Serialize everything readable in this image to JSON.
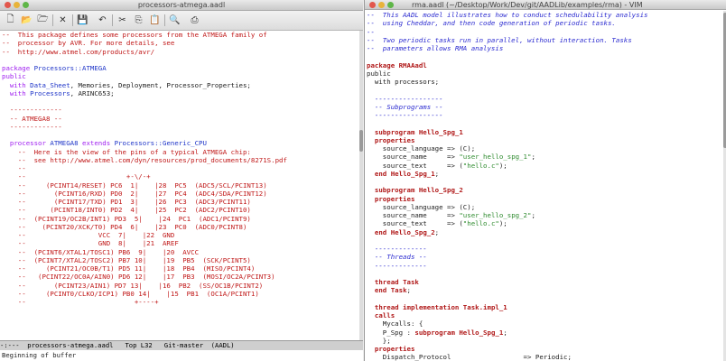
{
  "left_window": {
    "title": "processors-atmega.aadl",
    "toolbar_icons": [
      {
        "name": "new-file-icon",
        "glyph": "🗋"
      },
      {
        "name": "open-folder-icon",
        "glyph": "📂"
      },
      {
        "name": "open-dir-icon",
        "glyph": "🗁"
      },
      {
        "name": "close-icon",
        "glyph": "✕"
      },
      {
        "name": "save-icon",
        "glyph": "💾"
      },
      {
        "name": "undo-icon",
        "glyph": "↶"
      },
      {
        "name": "cut-icon",
        "glyph": "✂"
      },
      {
        "name": "copy-icon",
        "glyph": "⎘"
      },
      {
        "name": "paste-icon",
        "glyph": "📋"
      },
      {
        "name": "search-icon",
        "glyph": "🔍"
      },
      {
        "name": "print-icon",
        "glyph": "⎙"
      }
    ],
    "lines": [
      [
        {
          "c": "com",
          "t": "--  This package defines some processors from the ATMEGA family of"
        }
      ],
      [
        {
          "c": "com",
          "t": "--  processor by AVR. For more details, see"
        }
      ],
      [
        {
          "c": "com",
          "t": "--  http://www.atmel.com/products/avr/"
        }
      ],
      [
        {
          "c": "txt",
          "t": ""
        }
      ],
      [
        {
          "c": "kw",
          "t": "package "
        },
        {
          "c": "type",
          "t": "Processors::ATMEGA"
        }
      ],
      [
        {
          "c": "kw",
          "t": "public"
        }
      ],
      [
        {
          "c": "txt",
          "t": "  "
        },
        {
          "c": "kw",
          "t": "with "
        },
        {
          "c": "type",
          "t": "Data_Sheet"
        },
        {
          "c": "txt",
          "t": ", Memories, Deployment, Processor_Properties;"
        }
      ],
      [
        {
          "c": "txt",
          "t": "  "
        },
        {
          "c": "kw",
          "t": "with "
        },
        {
          "c": "type",
          "t": "Processors"
        },
        {
          "c": "txt",
          "t": ", ARINC653;"
        }
      ],
      [
        {
          "c": "txt",
          "t": ""
        }
      ],
      [
        {
          "c": "com",
          "t": "  -------------"
        }
      ],
      [
        {
          "c": "com",
          "t": "  -- ATMEGA8 --"
        }
      ],
      [
        {
          "c": "com",
          "t": "  -------------"
        }
      ],
      [
        {
          "c": "txt",
          "t": ""
        }
      ],
      [
        {
          "c": "txt",
          "t": "  "
        },
        {
          "c": "kw",
          "t": "processor "
        },
        {
          "c": "type",
          "t": "ATMEGA8"
        },
        {
          "c": "kw",
          "t": " extends "
        },
        {
          "c": "type",
          "t": "Processors::Generic_CPU"
        }
      ],
      [
        {
          "c": "com",
          "t": "    --  Here is the view of the pins of a typical ATMEGA chip:"
        }
      ],
      [
        {
          "c": "com",
          "t": "    --  see http://www.atmel.com/dyn/resources/prod_documents/8271S.pdf"
        }
      ],
      [
        {
          "c": "com",
          "t": "    --"
        }
      ],
      [
        {
          "c": "com",
          "t": "    --                         +-\\/-+"
        }
      ],
      [
        {
          "c": "com",
          "t": "    --     (PCINT14/RESET) PC6  1|    |28  PC5  (ADC5/SCL/PCINT13)"
        }
      ],
      [
        {
          "c": "com",
          "t": "    --       (PCINT16/RXD) PD0  2|    |27  PC4  (ADC4/SDA/PCINT12)"
        }
      ],
      [
        {
          "c": "com",
          "t": "    --       (PCINT17/TXD) PD1  3|    |26  PC3  (ADC3/PCINT11)"
        }
      ],
      [
        {
          "c": "com",
          "t": "    --      (PCINT18/INT0) PD2  4|    |25  PC2  (ADC2/PCINT10)"
        }
      ],
      [
        {
          "c": "com",
          "t": "    --  (PCINT19/OC2B/INT1) PD3  5|    |24  PC1  (ADC1/PCINT9)"
        }
      ],
      [
        {
          "c": "com",
          "t": "    --    (PCINT20/XCK/T0) PD4  6|    |23  PC0  (ADC0/PCINT8)"
        }
      ],
      [
        {
          "c": "com",
          "t": "    --                  VCC  7|    |22  GND"
        }
      ],
      [
        {
          "c": "com",
          "t": "    --                  GND  8|    |21  AREF"
        }
      ],
      [
        {
          "c": "com",
          "t": "    --  (PCINT6/XTAL1/TOSC1) PB6  9|    |20  AVCC"
        }
      ],
      [
        {
          "c": "com",
          "t": "    --  (PCINT7/XTAL2/TOSC2) PB7 10|    |19  PB5  (SCK/PCINT5)"
        }
      ],
      [
        {
          "c": "com",
          "t": "    --     (PCINT21/OC0B/T1) PD5 11|    |18  PB4  (MISO/PCINT4)"
        }
      ],
      [
        {
          "c": "com",
          "t": "    --   (PCINT22/OC0A/AIN0) PD6 12|    |17  PB3  (MOSI/OC2A/PCINT3)"
        }
      ],
      [
        {
          "c": "com",
          "t": "    --       (PCINT23/AIN1) PD7 13|    |16  PB2  (SS/OC1B/PCINT2)"
        }
      ],
      [
        {
          "c": "com",
          "t": "    --     (PCINT0/CLKO/ICP1) PB0 14|    |15  PB1  (OC1A/PCINT1)"
        }
      ],
      [
        {
          "c": "com",
          "t": "    --                           +----+"
        }
      ]
    ],
    "modeline": "-:---  processors-atmega.aadl   Top L32   Git-master  (AADL)",
    "minibuffer": "Beginning of buffer"
  },
  "right_window": {
    "title": "rma.aadl (~/Desktop/Work/Dev/git/AADLib/examples/rma) - VIM",
    "lines": [
      [
        {
          "c": "com",
          "t": "--  This AADL model illustrates how to conduct schedulability analysis"
        }
      ],
      [
        {
          "c": "com",
          "t": "--  using Cheddar, and then code generation of periodic tasks."
        }
      ],
      [
        {
          "c": "com",
          "t": "--"
        }
      ],
      [
        {
          "c": "com",
          "t": "--  Two periodic tasks run in parallel, without interaction. Tasks"
        }
      ],
      [
        {
          "c": "com",
          "t": "--  parameters allows RMA analysis"
        }
      ],
      [
        {
          "c": "txt",
          "t": ""
        }
      ],
      [
        {
          "c": "kw",
          "t": "package "
        },
        {
          "c": "kw",
          "t": "RMAAadl"
        }
      ],
      [
        {
          "c": "txt",
          "t": "public"
        }
      ],
      [
        {
          "c": "txt",
          "t": "  with processors;"
        }
      ],
      [
        {
          "c": "txt",
          "t": ""
        }
      ],
      [
        {
          "c": "com",
          "t": "  -----------------"
        }
      ],
      [
        {
          "c": "com",
          "t": "  -- Subprograms --"
        }
      ],
      [
        {
          "c": "com",
          "t": "  -----------------"
        }
      ],
      [
        {
          "c": "txt",
          "t": ""
        }
      ],
      [
        {
          "c": "txt",
          "t": "  "
        },
        {
          "c": "kw",
          "t": "subprogram "
        },
        {
          "c": "kw",
          "t": "Hello_Spg_1"
        }
      ],
      [
        {
          "c": "txt",
          "t": "  "
        },
        {
          "c": "kw",
          "t": "properties"
        }
      ],
      [
        {
          "c": "txt",
          "t": "    source_language => (C);"
        }
      ],
      [
        {
          "c": "txt",
          "t": "    source_name     => "
        },
        {
          "c": "str",
          "t": "\"user_hello_spg_1\""
        },
        {
          "c": "txt",
          "t": ";"
        }
      ],
      [
        {
          "c": "txt",
          "t": "    source_text     => ("
        },
        {
          "c": "str",
          "t": "\"hello.c\""
        },
        {
          "c": "txt",
          "t": ");"
        }
      ],
      [
        {
          "c": "txt",
          "t": "  "
        },
        {
          "c": "kw",
          "t": "end "
        },
        {
          "c": "kw",
          "t": "Hello_Spg_1"
        },
        {
          "c": "txt",
          "t": ";"
        }
      ],
      [
        {
          "c": "txt",
          "t": ""
        }
      ],
      [
        {
          "c": "txt",
          "t": "  "
        },
        {
          "c": "kw",
          "t": "subprogram "
        },
        {
          "c": "kw",
          "t": "Hello_Spg_2"
        }
      ],
      [
        {
          "c": "txt",
          "t": "  "
        },
        {
          "c": "kw",
          "t": "properties"
        }
      ],
      [
        {
          "c": "txt",
          "t": "    source_language => (C);"
        }
      ],
      [
        {
          "c": "txt",
          "t": "    source_name     => "
        },
        {
          "c": "str",
          "t": "\"user_hello_spg_2\""
        },
        {
          "c": "txt",
          "t": ";"
        }
      ],
      [
        {
          "c": "txt",
          "t": "    source_text     => ("
        },
        {
          "c": "str",
          "t": "\"hello.c\""
        },
        {
          "c": "txt",
          "t": ");"
        }
      ],
      [
        {
          "c": "txt",
          "t": "  "
        },
        {
          "c": "kw",
          "t": "end "
        },
        {
          "c": "kw",
          "t": "Hello_Spg_2"
        },
        {
          "c": "txt",
          "t": ";"
        }
      ],
      [
        {
          "c": "txt",
          "t": ""
        }
      ],
      [
        {
          "c": "com",
          "t": "  -------------"
        }
      ],
      [
        {
          "c": "com",
          "t": "  -- Threads --"
        }
      ],
      [
        {
          "c": "com",
          "t": "  -------------"
        }
      ],
      [
        {
          "c": "txt",
          "t": ""
        }
      ],
      [
        {
          "c": "txt",
          "t": "  "
        },
        {
          "c": "kw",
          "t": "thread "
        },
        {
          "c": "kw",
          "t": "Task"
        }
      ],
      [
        {
          "c": "txt",
          "t": "  "
        },
        {
          "c": "kw",
          "t": "end "
        },
        {
          "c": "kw",
          "t": "Task"
        },
        {
          "c": "txt",
          "t": ";"
        }
      ],
      [
        {
          "c": "txt",
          "t": ""
        }
      ],
      [
        {
          "c": "txt",
          "t": "  "
        },
        {
          "c": "kw",
          "t": "thread implementation "
        },
        {
          "c": "kw",
          "t": "Task.impl_1"
        }
      ],
      [
        {
          "c": "txt",
          "t": "  "
        },
        {
          "c": "kw",
          "t": "calls"
        }
      ],
      [
        {
          "c": "txt",
          "t": "    Mycalls: {"
        }
      ],
      [
        {
          "c": "txt",
          "t": "    P_Spg : "
        },
        {
          "c": "kw",
          "t": "subprogram "
        },
        {
          "c": "kw",
          "t": "Hello_Spg_1"
        },
        {
          "c": "txt",
          "t": ";"
        }
      ],
      [
        {
          "c": "txt",
          "t": "    };"
        }
      ],
      [
        {
          "c": "txt",
          "t": "  "
        },
        {
          "c": "kw",
          "t": "properties"
        }
      ],
      [
        {
          "c": "txt",
          "t": "    Dispatch_Protocol                  => Periodic;"
        }
      ]
    ]
  },
  "colors": {
    "emacs_comment": "#c01818",
    "emacs_keyword": "#a020f0",
    "emacs_type": "#1f35c8",
    "vim_comment": "#2b2bd0",
    "vim_keyword": "#b01818",
    "vim_string": "#2e8b2e"
  }
}
